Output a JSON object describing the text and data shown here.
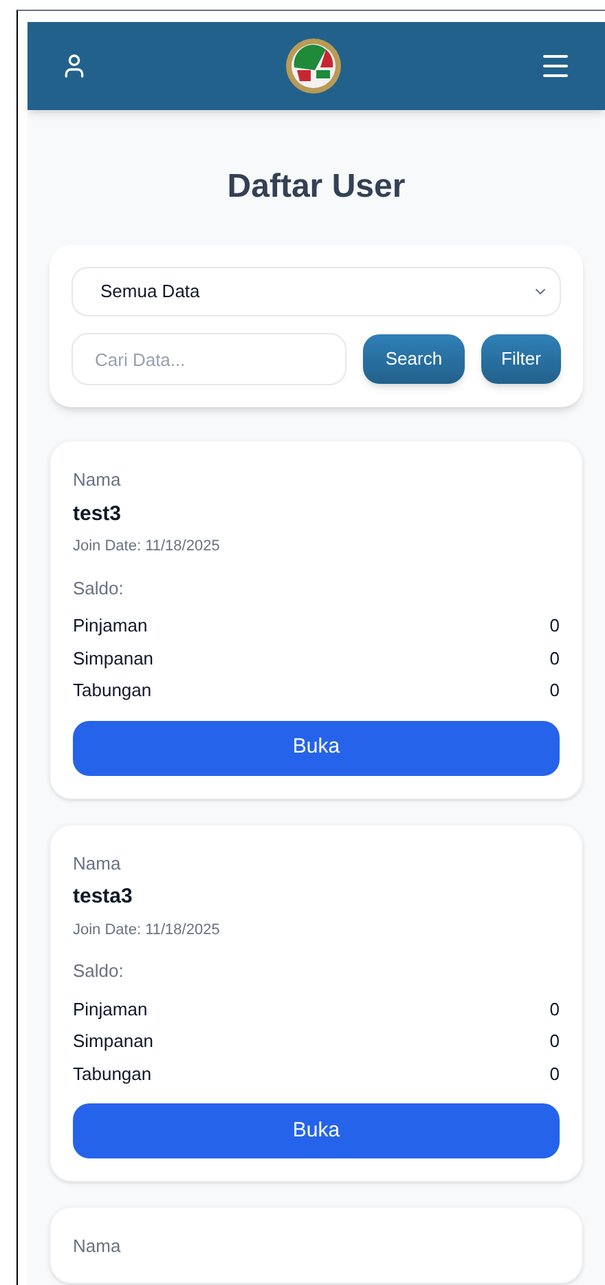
{
  "header": {
    "title": "Daftar User"
  },
  "filter": {
    "select_value": "Semua Data",
    "search_placeholder": "Cari Data...",
    "buttons": [
      "Search",
      "Filter"
    ]
  },
  "users": [
    {
      "name_label": "Nama",
      "name": "test3",
      "join_date": "Join Date: 11/18/2025",
      "saldo_label": "Saldo:",
      "balances": [
        {
          "label": "Pinjaman",
          "value": "0"
        },
        {
          "label": "Simpanan",
          "value": "0"
        },
        {
          "label": "Tabungan",
          "value": "0"
        }
      ],
      "button": "Buka"
    },
    {
      "name_label": "Nama",
      "name": "testa3",
      "join_date": "Join Date: 11/18/2025",
      "saldo_label": "Saldo:",
      "balances": [
        {
          "label": "Pinjaman",
          "value": "0"
        },
        {
          "label": "Simpanan",
          "value": "0"
        },
        {
          "label": "Tabungan",
          "value": "0"
        }
      ],
      "button": "Buka"
    },
    {
      "name_label": "Nama"
    }
  ]
}
